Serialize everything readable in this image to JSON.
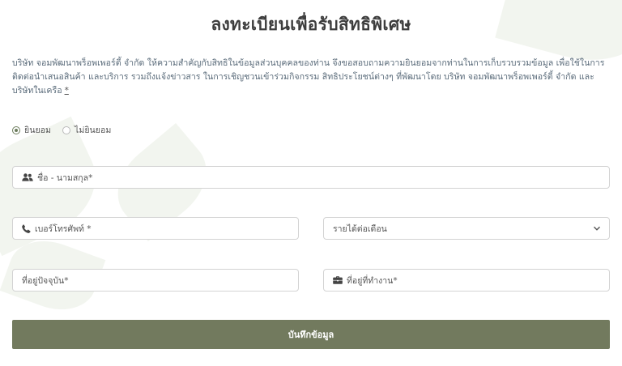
{
  "page": {
    "title": "ลงทะเบียนเพื่อรับสิทธิพิเศษ"
  },
  "consent": {
    "text": "บริษัท จอมพัฒนาพร็อพเพอร์ตี้ จำกัด ให้ความสำคัญกับสิทธิในข้อมูลส่วนบุคคลของท่าน จึงขอสอบถามความยินยอมจากท่านในการเก็บรวบรวมข้อมูล เพื่อใช้ในการติดต่อนำเสนอสินค้า และบริการ รวมถึงแจ้งข่าวสาร ในการเชิญชวนเข้าร่วมกิจกรรม สิทธิประโยชน์ต่างๆ ที่พัฒนาโดย บริษัท จอมพัฒนาพร็อพเพอร์ตี้ จำกัด และบริษัทในเครือ",
    "required_mark": "*",
    "options": [
      {
        "label": "ยินยอม",
        "selected": true
      },
      {
        "label": "ไม่ยินยอม",
        "selected": false
      }
    ]
  },
  "form": {
    "name_placeholder": "ชื่อ - นามสกุล*",
    "phone_placeholder": "เบอร์โทรศัพท์ *",
    "income_selected": "รายได้ต่อเดือน",
    "address_placeholder": "ที่อยู่ปัจจุบัน*",
    "work_address_placeholder": "ที่อยู่ที่ทำงาน*",
    "submit_label": "บันทึกข้อมูล"
  },
  "colors": {
    "accent": "#727a5e",
    "radio_on": "#6b7b5b",
    "text_muted": "#5a6b7a"
  },
  "icons": {
    "name": "users-icon",
    "phone": "phone-icon",
    "work": "briefcase-icon",
    "select": "chevron-down-icon"
  }
}
